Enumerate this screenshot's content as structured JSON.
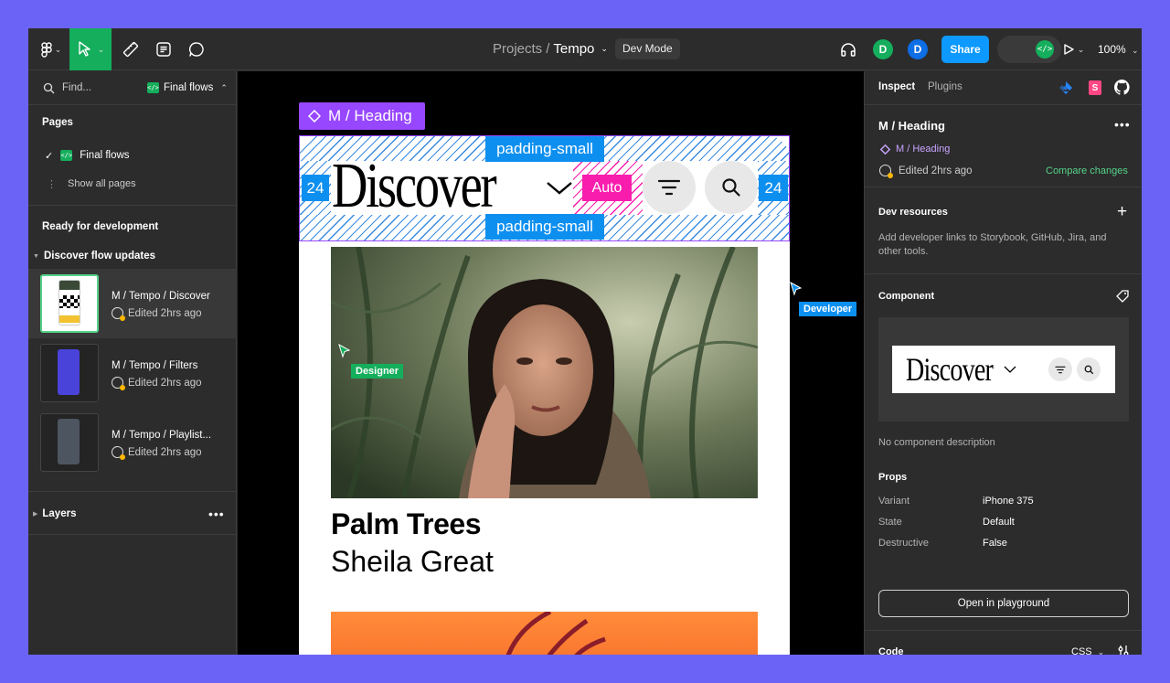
{
  "toolbar": {
    "breadcrumb_parent": "Projects",
    "breadcrumb_sep": "/",
    "breadcrumb_current": "Tempo",
    "dev_mode_label": "Dev Mode",
    "avatar1": "D",
    "avatar2": "D",
    "share_label": "Share",
    "zoom": "100%",
    "colors": {
      "move_tool": "#14ae5c",
      "share": "#0d99ff",
      "avatar1": "#14ae5c",
      "avatar2": "#0d6ee6"
    }
  },
  "left": {
    "search_placeholder": "Find...",
    "page_switch": "Final flows",
    "pages_heading": "Pages",
    "current_page": "Final flows",
    "show_all": "Show all pages",
    "ready_heading": "Ready for development",
    "section": "Discover flow updates",
    "flows": [
      {
        "title": "M / Tempo / Discover",
        "sub": "Edited 2hrs ago"
      },
      {
        "title": "M / Tempo / Filters",
        "sub": "Edited 2hrs ago"
      },
      {
        "title": "M / Tempo / Playlist...",
        "sub": "Edited 2hrs ago"
      }
    ],
    "layers": "Layers"
  },
  "canvas": {
    "component_tag": "M / Heading",
    "padding_top": "padding-small",
    "padding_bottom": "padding-small",
    "left_pad": "24",
    "right_pad": "24",
    "auto": "Auto",
    "heading": "Discover",
    "card_title": "Palm Trees",
    "card_artist": "Sheila Great",
    "cursor_designer": "Designer",
    "cursor_developer": "Developer",
    "colors": {
      "designer": "#14ae5c",
      "developer": "#0d8ff0",
      "component": "#9747ff",
      "auto": "#f91dad"
    }
  },
  "right": {
    "tab_inspect": "Inspect",
    "tab_plugins": "Plugins",
    "title": "M / Heading",
    "component_link": "M / Heading",
    "edited": "Edited 2hrs ago",
    "compare": "Compare changes",
    "dev_resources": "Dev resources",
    "dev_resources_desc": "Add developer links to Storybook, GitHub, Jira, and other tools.",
    "component_heading": "Component",
    "preview_heading": "Discover",
    "no_description": "No component description",
    "props_heading": "Props",
    "props": [
      {
        "name": "Variant",
        "value": "iPhone 375"
      },
      {
        "name": "State",
        "value": "Default"
      },
      {
        "name": "Destructive",
        "value": "False"
      }
    ],
    "playground": "Open in playground",
    "code_heading": "Code",
    "code_lang": "CSS"
  }
}
